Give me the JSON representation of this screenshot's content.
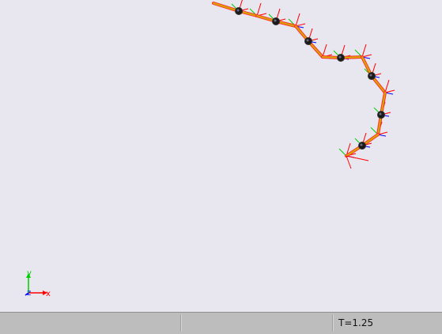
{
  "statusbar": {
    "time_readout": "T=1.25"
  },
  "axes_gizmo": {
    "x_label": "x",
    "y_label": "y",
    "z_label": "z",
    "x_color": "#ff0000",
    "y_color": "#00cc00",
    "z_color": "#0000ff"
  },
  "scene": {
    "background_color": "#e8e6ef",
    "link_color": "#d8a800",
    "joint_color": "#1a1a1a",
    "frame_colors": {
      "x": "#ff0000",
      "y": "#00cc00",
      "z": "#0000ff"
    },
    "joint_count": 9
  }
}
